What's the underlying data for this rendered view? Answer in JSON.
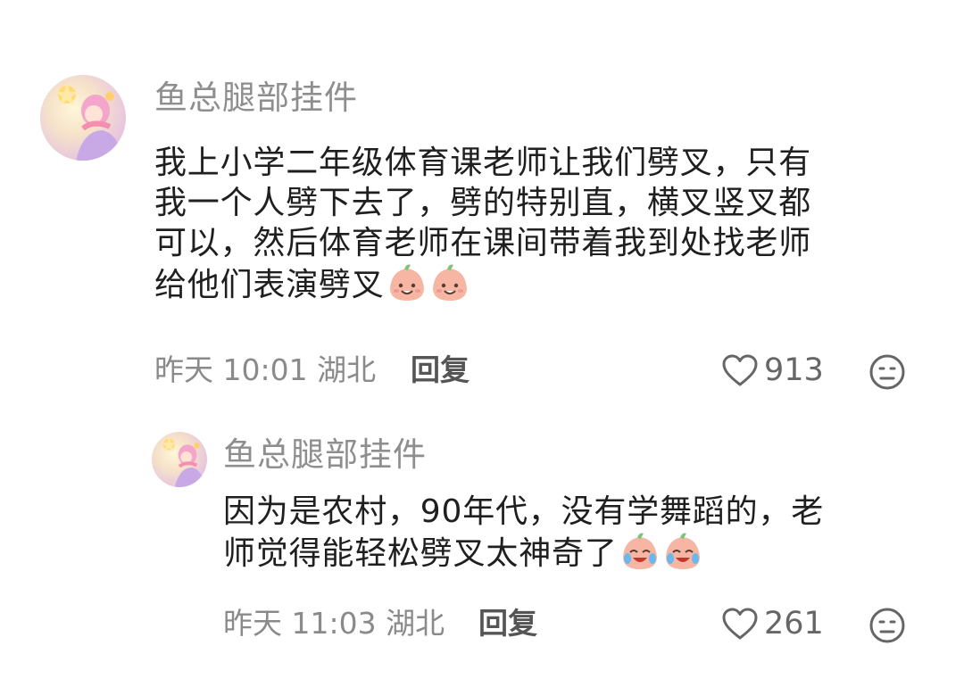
{
  "comment": {
    "username": "鱼总腿部挂件",
    "lines": [
      "我上小学二年级体育课老师让我们劈叉，只有",
      "我一个人劈下去了，劈的特别直，横叉竖叉都",
      "可以，然后体育老师在课间带着我到处找老师",
      "给他们表演劈叉"
    ],
    "emojis": [
      "smile-peach-emoji",
      "smile-peach-emoji"
    ],
    "time": "昨天 10:01 湖北",
    "reply_label": "回复",
    "likes": "913"
  },
  "reply": {
    "username": "鱼总腿部挂件",
    "lines": [
      "因为是农村，90年代，没有学舞蹈的，老",
      "师觉得能轻松劈叉太神奇了"
    ],
    "emojis": [
      "laugh-cry-peach-emoji",
      "laugh-cry-peach-emoji"
    ],
    "time": "昨天 11:03 湖北",
    "reply_label": "回复",
    "likes": "261"
  },
  "colors": {
    "username": "#8e8e8e",
    "text": "#1f1f1f",
    "meta": "#8a8a8a",
    "peach": "#f7b6a3"
  }
}
